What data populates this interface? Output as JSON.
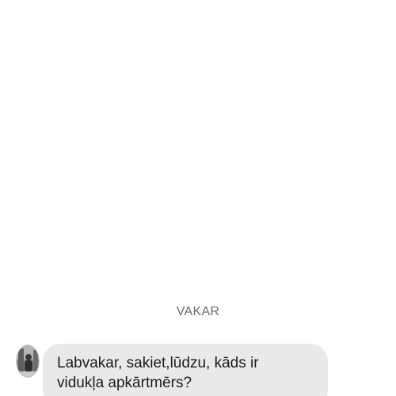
{
  "chat": {
    "date_separator": "VAKAR",
    "messages": [
      {
        "sender": "incoming",
        "avatar_icon": "user-avatar-photo",
        "lines": [
          "Labvakar, sakiet,lūdzu, kāds ir",
          "vidukļa apkārtmērs?"
        ]
      }
    ]
  },
  "colors": {
    "bubble_incoming": "#e9e9eb",
    "separator_text": "#6b6b6b",
    "message_text": "#1c1c1e"
  }
}
